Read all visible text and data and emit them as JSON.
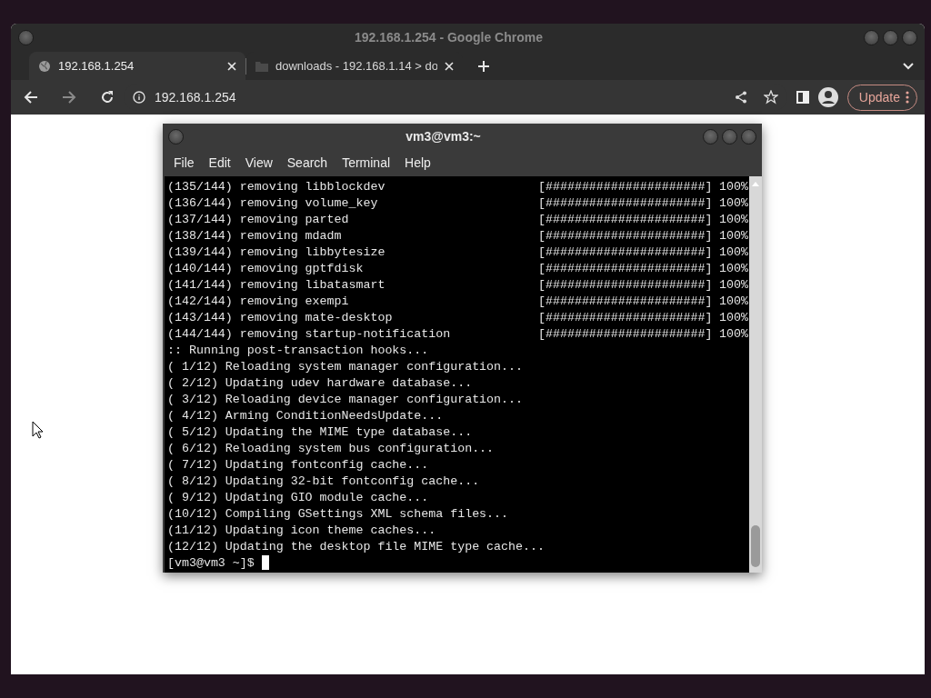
{
  "browser": {
    "title": "192.168.1.254 - Google Chrome",
    "tabs": [
      {
        "title": "192.168.1.254",
        "selected": true,
        "kind": "globe"
      },
      {
        "title": "downloads - 192.168.1.14 > do",
        "selected": false,
        "kind": "folder"
      }
    ],
    "address": "192.168.1.254",
    "update_button": "Update"
  },
  "terminal": {
    "title": "vm3@vm3:~",
    "menu": [
      "File",
      "Edit",
      "View",
      "Search",
      "Terminal",
      "Help"
    ],
    "lines": [
      {
        "kind": "progress",
        "text": "(135/144) removing libblockdev",
        "bar": "[######################]",
        "percent": "100%"
      },
      {
        "kind": "progress",
        "text": "(136/144) removing volume_key",
        "bar": "[######################]",
        "percent": "100%"
      },
      {
        "kind": "progress",
        "text": "(137/144) removing parted",
        "bar": "[######################]",
        "percent": "100%"
      },
      {
        "kind": "progress",
        "text": "(138/144) removing mdadm",
        "bar": "[######################]",
        "percent": "100%"
      },
      {
        "kind": "progress",
        "text": "(139/144) removing libbytesize",
        "bar": "[######################]",
        "percent": "100%"
      },
      {
        "kind": "progress",
        "text": "(140/144) removing gptfdisk",
        "bar": "[######################]",
        "percent": "100%"
      },
      {
        "kind": "progress",
        "text": "(141/144) removing libatasmart",
        "bar": "[######################]",
        "percent": "100%"
      },
      {
        "kind": "progress",
        "text": "(142/144) removing exempi",
        "bar": "[######################]",
        "percent": "100%"
      },
      {
        "kind": "progress",
        "text": "(143/144) removing mate-desktop",
        "bar": "[######################]",
        "percent": "100%"
      },
      {
        "kind": "progress",
        "text": "(144/144) removing startup-notification",
        "bar": "[######################]",
        "percent": "100%"
      },
      {
        "kind": "plain",
        "text": ":: Running post-transaction hooks..."
      },
      {
        "kind": "plain",
        "text": "( 1/12) Reloading system manager configuration..."
      },
      {
        "kind": "plain",
        "text": "( 2/12) Updating udev hardware database..."
      },
      {
        "kind": "plain",
        "text": "( 3/12) Reloading device manager configuration..."
      },
      {
        "kind": "plain",
        "text": "( 4/12) Arming ConditionNeedsUpdate..."
      },
      {
        "kind": "plain",
        "text": "( 5/12) Updating the MIME type database..."
      },
      {
        "kind": "plain",
        "text": "( 6/12) Reloading system bus configuration..."
      },
      {
        "kind": "plain",
        "text": "( 7/12) Updating fontconfig cache..."
      },
      {
        "kind": "plain",
        "text": "( 8/12) Updating 32-bit fontconfig cache..."
      },
      {
        "kind": "plain",
        "text": "( 9/12) Updating GIO module cache..."
      },
      {
        "kind": "plain",
        "text": "(10/12) Compiling GSettings XML schema files..."
      },
      {
        "kind": "plain",
        "text": "(11/12) Updating icon theme caches..."
      },
      {
        "kind": "plain",
        "text": "(12/12) Updating the desktop file MIME type cache..."
      }
    ],
    "prompt": "[vm3@vm3 ~]$"
  }
}
